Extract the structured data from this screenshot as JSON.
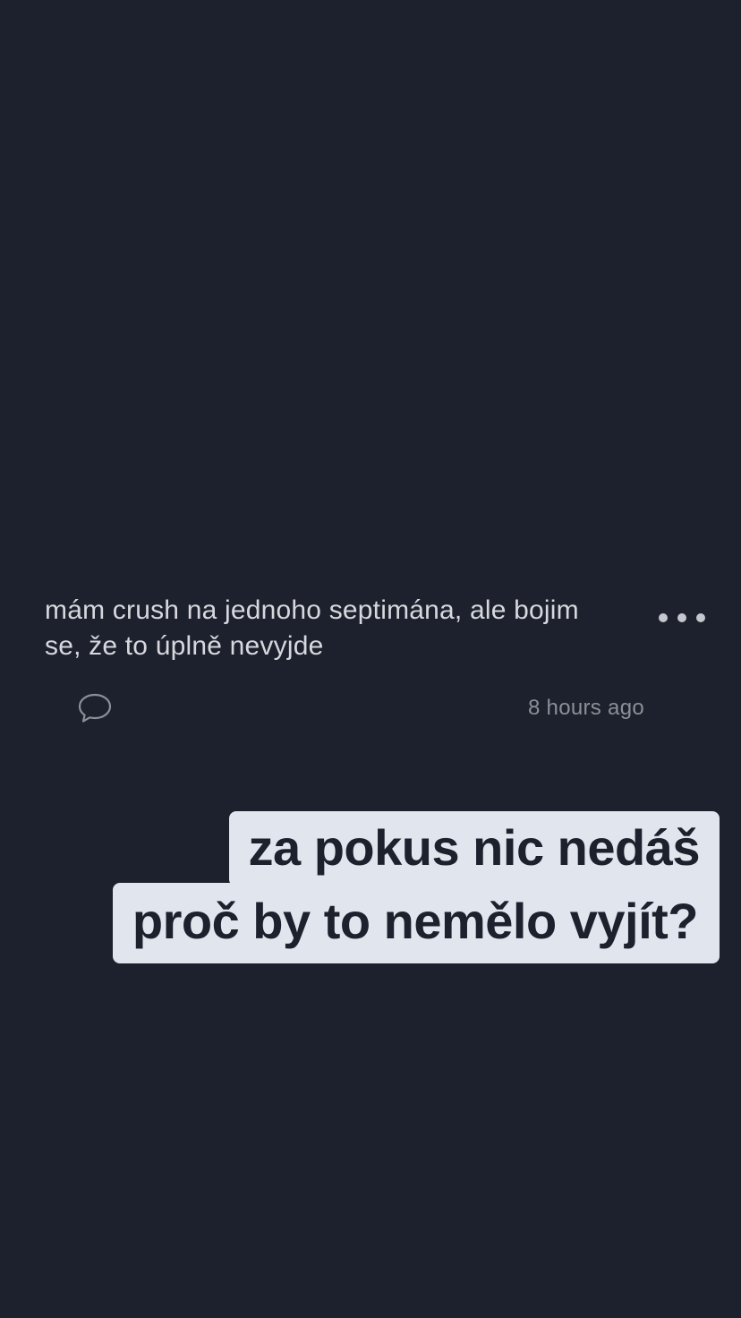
{
  "post": {
    "text_line1": "mám crush na jednoho septimána, ale bojim",
    "text_line2": "se, že to úplně nevyjde",
    "timestamp": "8 hours ago",
    "icons": {
      "more": "more-dots-icon",
      "comment": "comment-bubble-icon"
    }
  },
  "caption": {
    "line1": "za pokus nic nedáš",
    "line2": "proč by to nemělo vyjít?"
  },
  "colors": {
    "background": "#1c212d",
    "post_text": "#d6d8dd",
    "meta_text": "#8c8f97",
    "caption_bg": "#e1e6ee",
    "caption_text": "#1c212d"
  }
}
